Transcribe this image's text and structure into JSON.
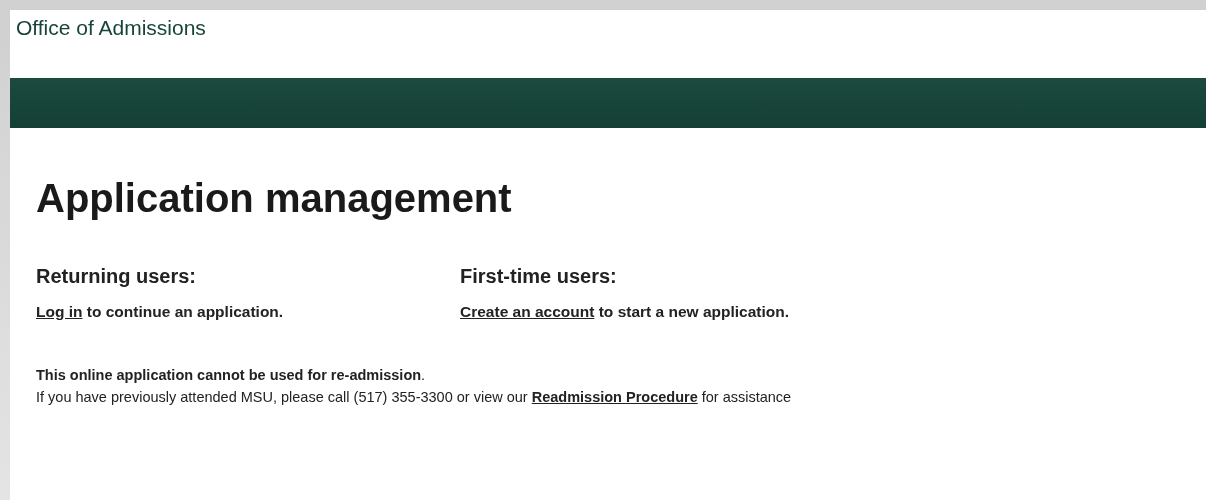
{
  "site_title": "Office of Admissions",
  "heading": "Application management",
  "columns": [
    {
      "title": "Returning users:",
      "link": "Log in",
      "text": " to continue an application."
    },
    {
      "title": "First-time users:",
      "link": "Create an account",
      "text": " to start a new application."
    }
  ],
  "notice": {
    "headline": "**This online application cannot be used for re-admission**.",
    "text_before": "If you have previously attended MSU, please call (517) 355-3300 or view our ",
    "link": "Readmission Procedure",
    "text_after": " for assistance"
  }
}
